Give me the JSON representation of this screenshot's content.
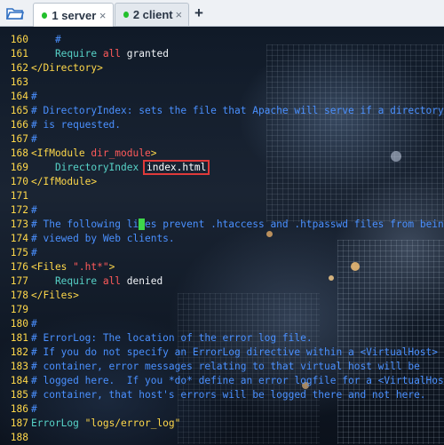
{
  "tabs": [
    {
      "label": "1 server",
      "status_color": "#22c02c",
      "active": true
    },
    {
      "label": "2 client",
      "status_color": "#22c02c",
      "active": false
    }
  ],
  "icons": {
    "folder": "folder-icon",
    "close": "close-icon",
    "add": "plus-icon"
  },
  "close_glyph": "×",
  "plus_glyph": "+",
  "lines": [
    {
      "n": "160",
      "parts": [
        {
          "t": "    #",
          "c": "comment"
        }
      ]
    },
    {
      "n": "161",
      "parts": [
        {
          "t": "    Require ",
          "c": "dir"
        },
        {
          "t": "all",
          "c": "red"
        },
        {
          "t": " granted",
          "c": "white"
        }
      ]
    },
    {
      "n": "162",
      "parts": [
        {
          "t": "</Directory>",
          "c": "tag"
        }
      ]
    },
    {
      "n": "163",
      "parts": []
    },
    {
      "n": "164",
      "parts": [
        {
          "t": "#",
          "c": "comment"
        }
      ]
    },
    {
      "n": "165",
      "parts": [
        {
          "t": "# DirectoryIndex: sets the file that Apache will serve if a directory",
          "c": "comment"
        }
      ]
    },
    {
      "n": "166",
      "parts": [
        {
          "t": "# is requested.",
          "c": "comment"
        }
      ]
    },
    {
      "n": "167",
      "parts": [
        {
          "t": "#",
          "c": "comment"
        }
      ]
    },
    {
      "n": "168",
      "parts": [
        {
          "t": "<IfModule ",
          "c": "tag"
        },
        {
          "t": "dir_module",
          "c": "red"
        },
        {
          "t": ">",
          "c": "tag"
        }
      ]
    },
    {
      "n": "169",
      "parts": [
        {
          "t": "    DirectoryIndex ",
          "c": "dir"
        },
        {
          "t": "index.html",
          "c": "white",
          "box": true
        }
      ]
    },
    {
      "n": "170",
      "parts": [
        {
          "t": "</IfModule>",
          "c": "tag"
        }
      ]
    },
    {
      "n": "171",
      "parts": []
    },
    {
      "n": "172",
      "parts": [
        {
          "t": "#",
          "c": "comment"
        }
      ]
    },
    {
      "n": "173",
      "parts": [
        {
          "t": "# The following li",
          "c": "comment"
        },
        {
          "t": "n",
          "c": "comment",
          "cursor": true
        },
        {
          "t": "es prevent .htaccess and .htpasswd files from being",
          "c": "comment"
        }
      ]
    },
    {
      "n": "174",
      "parts": [
        {
          "t": "# viewed by Web clients.",
          "c": "comment"
        }
      ]
    },
    {
      "n": "175",
      "parts": [
        {
          "t": "#",
          "c": "comment"
        }
      ]
    },
    {
      "n": "176",
      "parts": [
        {
          "t": "<Files ",
          "c": "tag"
        },
        {
          "t": "\".ht*\"",
          "c": "red"
        },
        {
          "t": ">",
          "c": "tag"
        }
      ]
    },
    {
      "n": "177",
      "parts": [
        {
          "t": "    Require ",
          "c": "dir"
        },
        {
          "t": "all",
          "c": "red"
        },
        {
          "t": " denied",
          "c": "white"
        }
      ]
    },
    {
      "n": "178",
      "parts": [
        {
          "t": "</Files>",
          "c": "tag"
        }
      ]
    },
    {
      "n": "179",
      "parts": []
    },
    {
      "n": "180",
      "parts": [
        {
          "t": "#",
          "c": "comment"
        }
      ]
    },
    {
      "n": "181",
      "parts": [
        {
          "t": "# ErrorLog: The location of the error log file.",
          "c": "comment"
        }
      ]
    },
    {
      "n": "182",
      "parts": [
        {
          "t": "# If you do not specify an ErrorLog directive within a <VirtualHost>",
          "c": "comment"
        }
      ]
    },
    {
      "n": "183",
      "parts": [
        {
          "t": "# container, error messages relating to that virtual host will be",
          "c": "comment"
        }
      ]
    },
    {
      "n": "184",
      "parts": [
        {
          "t": "# logged here.  If you *do* define an error logfile for a <VirtualHost>",
          "c": "comment"
        }
      ]
    },
    {
      "n": "185",
      "parts": [
        {
          "t": "# container, that host's errors will be logged there and not here.",
          "c": "comment"
        }
      ]
    },
    {
      "n": "186",
      "parts": [
        {
          "t": "#",
          "c": "comment"
        }
      ]
    },
    {
      "n": "187",
      "parts": [
        {
          "t": "ErrorLog ",
          "c": "dir"
        },
        {
          "t": "\"logs/error_log\"",
          "c": "str"
        }
      ]
    },
    {
      "n": "188",
      "parts": []
    }
  ]
}
